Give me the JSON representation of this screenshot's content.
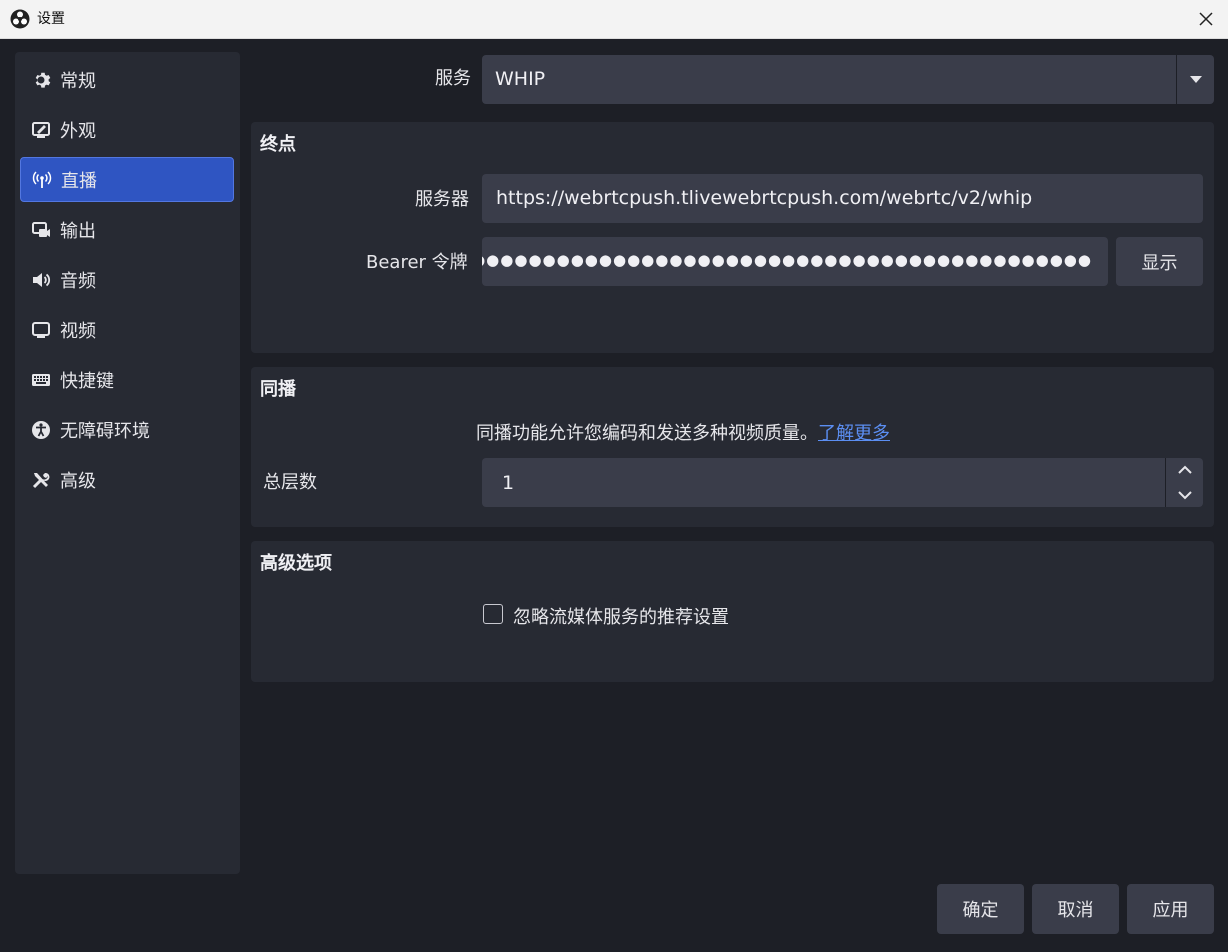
{
  "window": {
    "title": "设置"
  },
  "sidebar": {
    "items": [
      {
        "label": "常规",
        "icon": "gear-icon"
      },
      {
        "label": "外观",
        "icon": "appearance-icon"
      },
      {
        "label": "直播",
        "icon": "antenna-icon"
      },
      {
        "label": "输出",
        "icon": "output-icon"
      },
      {
        "label": "音频",
        "icon": "speaker-icon"
      },
      {
        "label": "视频",
        "icon": "monitor-icon"
      },
      {
        "label": "快捷键",
        "icon": "keyboard-icon"
      },
      {
        "label": "无障碍环境",
        "icon": "accessibility-icon"
      },
      {
        "label": "高级",
        "icon": "tools-icon"
      }
    ],
    "active_index": 2
  },
  "service": {
    "label": "服务",
    "value": "WHIP"
  },
  "endpoint": {
    "title": "终点",
    "server_label": "服务器",
    "server_value": "https://webrtcpush.tlivewebrtcpush.com/webrtc/v2/whip",
    "token_label": "Bearer 令牌",
    "token_value": "●●●●●●●●●●●●●●●●●●●●●●●●●●●●●●●●●●●●●●●●●●●●●●●●●●●●●●●",
    "show_button": "显示"
  },
  "simulcast": {
    "title": "同播",
    "description": "同播功能允许您编码和发送多种视频质量。",
    "learn_more": "了解更多",
    "layers_label": "总层数",
    "layers_value": "1"
  },
  "advanced": {
    "title": "高级选项",
    "ignore_checkbox_label": "忽略流媒体服务的推荐设置",
    "ignore_checked": false
  },
  "footer": {
    "ok": "确定",
    "cancel": "取消",
    "apply": "应用"
  },
  "colors": {
    "accent": "#2f55c2",
    "background": "#1d1f26",
    "panel": "#272a33",
    "field": "#3a3d4a",
    "link": "#5b8ef2"
  }
}
